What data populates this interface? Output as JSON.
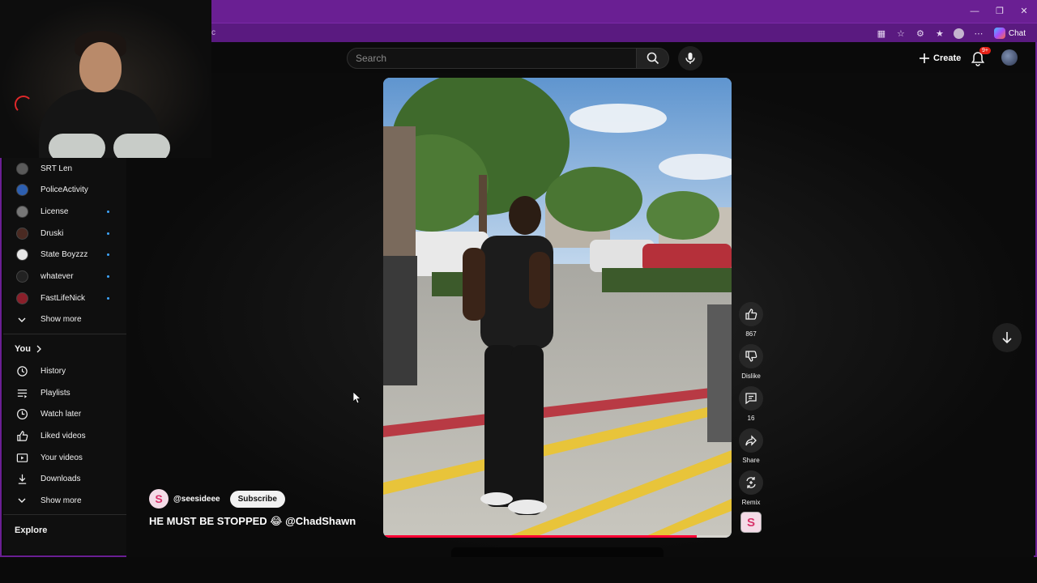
{
  "browser": {
    "address_tail": "c",
    "chat_label": "Chat",
    "window_controls": [
      "minimize-icon",
      "restore-icon",
      "close-icon"
    ]
  },
  "header": {
    "search_placeholder": "Search",
    "create_label": "Create",
    "notification_badge": "9+"
  },
  "sidebar": {
    "subscriptions": [
      {
        "label": "SRT Len",
        "new": false,
        "color": "#5a5a5a"
      },
      {
        "label": "PoliceActivity",
        "new": false,
        "color": "#2d5fb0"
      },
      {
        "label": "License",
        "new": true,
        "color": "#777777"
      },
      {
        "label": "Druski",
        "new": true,
        "color": "#4a2a22"
      },
      {
        "label": "State Boyzzz",
        "new": true,
        "color": "#e8e8e8"
      },
      {
        "label": "whatever",
        "new": true,
        "color": "#222222"
      },
      {
        "label": "FastLifeNick",
        "new": true,
        "color": "#8a1f2a"
      }
    ],
    "show_more_1": "Show more",
    "you_heading": "You",
    "you_items": [
      {
        "label": "History",
        "icon": "history-icon"
      },
      {
        "label": "Playlists",
        "icon": "playlists-icon"
      },
      {
        "label": "Watch later",
        "icon": "watch-later-icon"
      },
      {
        "label": "Liked videos",
        "icon": "liked-videos-icon"
      },
      {
        "label": "Your videos",
        "icon": "your-videos-icon"
      },
      {
        "label": "Downloads",
        "icon": "downloads-icon"
      }
    ],
    "show_more_2": "Show more",
    "explore_heading": "Explore"
  },
  "short": {
    "channel_handle": "@seesideee",
    "subscribe_label": "Subscribe",
    "caption": "HE MUST BE STOPPED 😂 @ChadShawn",
    "progress": 0.9,
    "actions": {
      "like_count": "867",
      "dislike_label": "Dislike",
      "comment_count": "16",
      "share_label": "Share",
      "remix_label": "Remix"
    }
  },
  "colors": {
    "browser_frame": "#6a1f93",
    "accent_red": "#ff0033",
    "new_dot": "#3ea6ff"
  }
}
